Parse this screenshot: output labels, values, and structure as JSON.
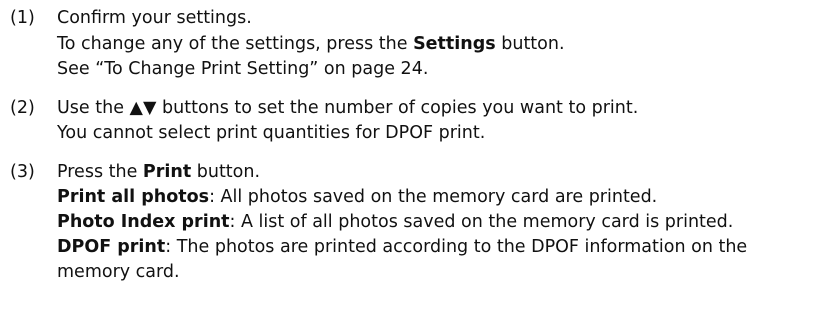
{
  "steps": [
    {
      "number": "(1)",
      "lines": [
        {
          "text": "Confirm your settings."
        },
        {
          "pre": "To change any of the settings, press the ",
          "bold": "Settings",
          "post": " button."
        },
        {
          "text": "See “To Change Print Setting” on page 24."
        }
      ]
    },
    {
      "number": "(2)",
      "lines": [
        {
          "pre": "Use the ",
          "bold": "▲▼",
          "post": " buttons to set the number of copies you want to print."
        },
        {
          "text": "You cannot select print quantities for DPOF print."
        }
      ]
    },
    {
      "number": "(3)",
      "lines": [
        {
          "pre": "Press the ",
          "bold": "Print",
          "post": " button."
        },
        {
          "bold": "Print all photos",
          "post": ": All photos saved on the memory card are printed."
        },
        {
          "bold": "Photo Index print",
          "post": ": A list of all photos saved on the memory card is printed."
        },
        {
          "bold": "DPOF print",
          "post": ": The photos are printed according to the DPOF information on the"
        },
        {
          "text": "memory card."
        }
      ]
    }
  ]
}
